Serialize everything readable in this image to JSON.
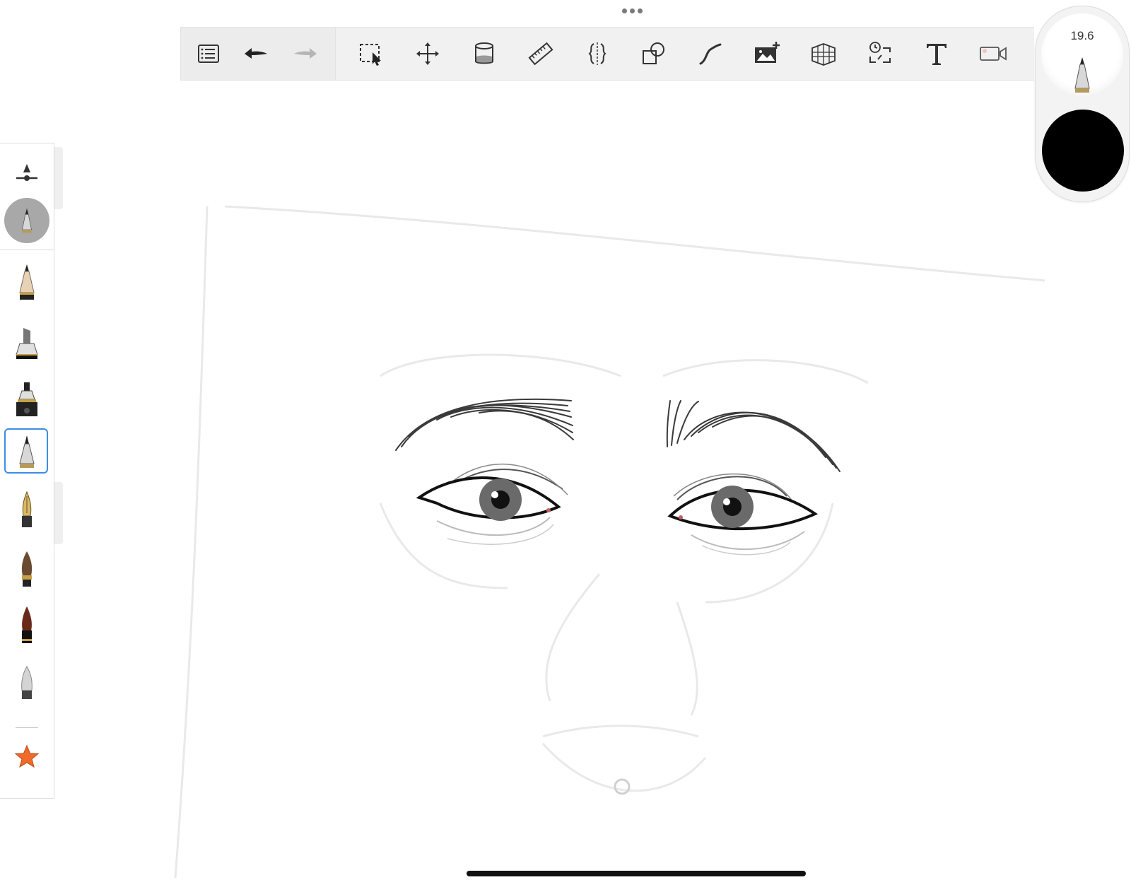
{
  "toolbar": {
    "tools": [
      {
        "name": "layers-list-icon"
      },
      {
        "name": "undo-icon"
      },
      {
        "name": "redo-icon"
      },
      {
        "name": "selection-icon"
      },
      {
        "name": "transform-icon"
      },
      {
        "name": "fill-bucket-icon"
      },
      {
        "name": "ruler-icon"
      },
      {
        "name": "symmetry-icon"
      },
      {
        "name": "shapes-icon"
      },
      {
        "name": "predictive-stroke-icon"
      },
      {
        "name": "add-image-icon"
      },
      {
        "name": "perspective-icon"
      },
      {
        "name": "time-lapse-icon"
      },
      {
        "name": "text-icon"
      },
      {
        "name": "record-icon"
      }
    ]
  },
  "puck": {
    "brush_size": "19.6",
    "color": "#000000"
  },
  "brushes": {
    "items": [
      "brush-settings",
      "current-brush",
      "pencil",
      "marker",
      "airbrush",
      "technical-pen",
      "fountain-pen",
      "paint-brush",
      "ink-brush",
      "soft-eraser",
      "favorites-star"
    ],
    "selected": "technical-pen"
  },
  "colors": {
    "selection": "#3a8ee6",
    "star": "#f06a2a"
  }
}
